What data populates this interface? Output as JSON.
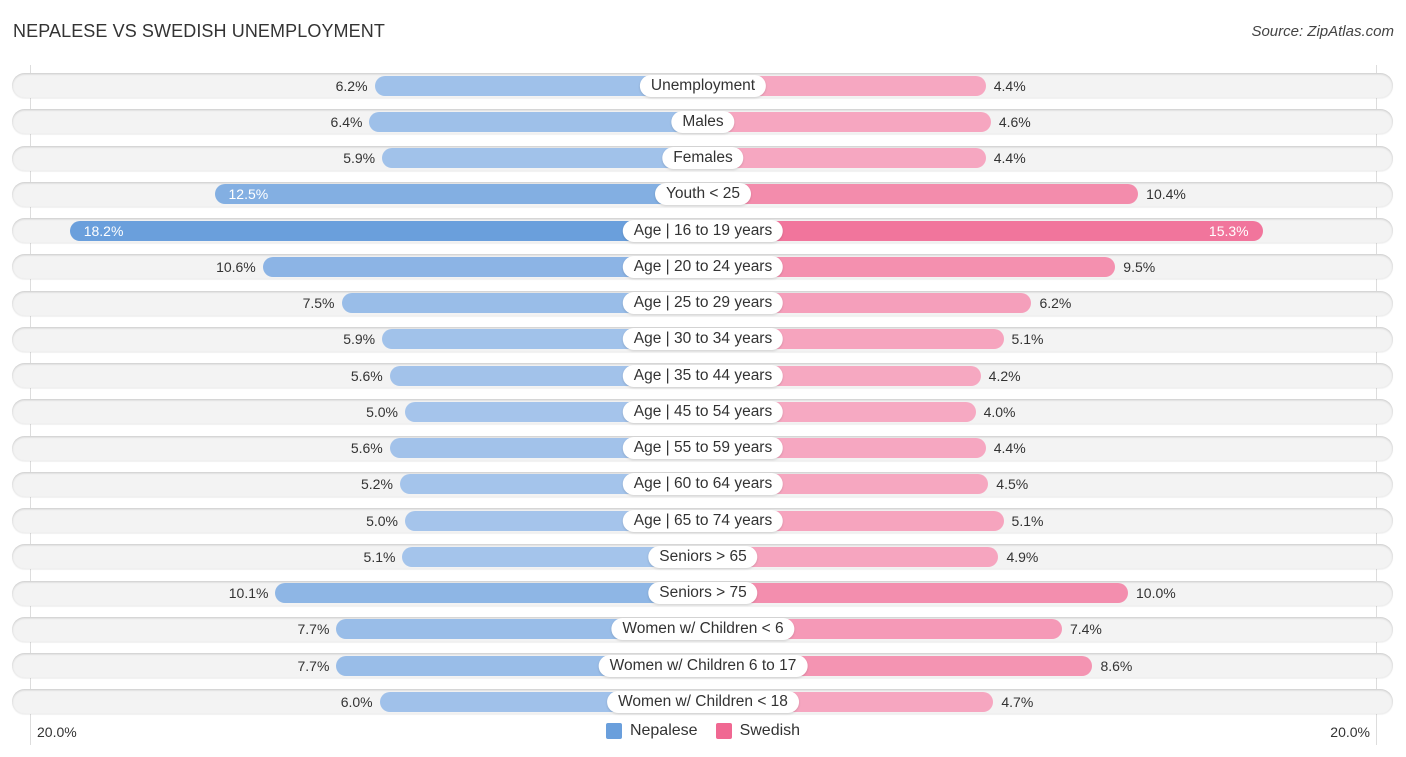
{
  "header": {
    "title": "NEPALESE VS SWEDISH UNEMPLOYMENT",
    "source": "Source: ZipAtlas.com"
  },
  "colors": {
    "nepalese": "#6a9fdc",
    "swedish": "#f06892",
    "nepalese_light": "#a9c7ec",
    "swedish_light": "#f6a9c2"
  },
  "axis": {
    "left_label": "20.0%",
    "right_label": "20.0%"
  },
  "legend": [
    {
      "name": "Nepalese",
      "color": "#6a9fdc"
    },
    {
      "name": "Swedish",
      "color": "#f06892"
    }
  ],
  "chart_data": {
    "type": "bar",
    "orientation": "diverging-horizontal",
    "title": "NEPALESE VS SWEDISH UNEMPLOYMENT",
    "xlim": [
      -20,
      20
    ],
    "unit": "%",
    "legend_position": "bottom-center",
    "categories": [
      "Unemployment",
      "Males",
      "Females",
      "Youth < 25",
      "Age | 16 to 19 years",
      "Age | 20 to 24 years",
      "Age | 25 to 29 years",
      "Age | 30 to 34 years",
      "Age | 35 to 44 years",
      "Age | 45 to 54 years",
      "Age | 55 to 59 years",
      "Age | 60 to 64 years",
      "Age | 65 to 74 years",
      "Seniors > 65",
      "Seniors > 75",
      "Women w/ Children < 6",
      "Women w/ Children 6 to 17",
      "Women w/ Children < 18"
    ],
    "series": [
      {
        "name": "Nepalese",
        "side": "left",
        "values": [
          6.2,
          6.4,
          5.9,
          12.5,
          18.2,
          10.6,
          7.5,
          5.9,
          5.6,
          5.0,
          5.6,
          5.2,
          5.0,
          5.1,
          10.1,
          7.7,
          7.7,
          6.0
        ],
        "labels": [
          "6.2%",
          "6.4%",
          "5.9%",
          "12.5%",
          "18.2%",
          "10.6%",
          "7.5%",
          "5.9%",
          "5.6%",
          "5.0%",
          "5.6%",
          "5.2%",
          "5.0%",
          "5.1%",
          "10.1%",
          "7.7%",
          "7.7%",
          "6.0%"
        ]
      },
      {
        "name": "Swedish",
        "side": "right",
        "values": [
          4.4,
          4.6,
          4.4,
          10.4,
          15.3,
          9.5,
          6.2,
          5.1,
          4.2,
          4.0,
          4.4,
          4.5,
          5.1,
          4.9,
          10.0,
          7.4,
          8.6,
          4.7
        ],
        "labels": [
          "4.4%",
          "4.6%",
          "4.4%",
          "10.4%",
          "15.3%",
          "9.5%",
          "6.2%",
          "5.1%",
          "4.2%",
          "4.0%",
          "4.4%",
          "4.5%",
          "5.1%",
          "4.9%",
          "10.0%",
          "7.4%",
          "8.6%",
          "4.7%"
        ]
      }
    ]
  }
}
